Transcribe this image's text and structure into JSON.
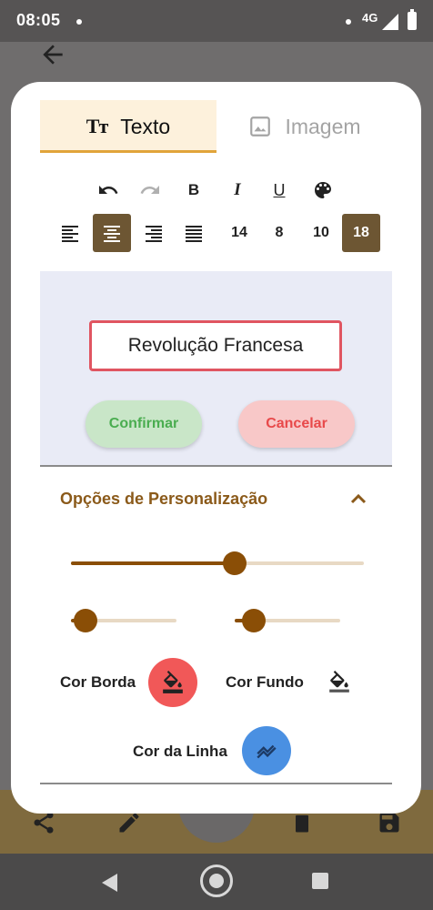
{
  "status_bar": {
    "time": "08:05",
    "network": "4G"
  },
  "tabs": [
    {
      "label": "Texto",
      "icon": "text-format-icon",
      "icon_glyph": "Tт",
      "selected": true
    },
    {
      "label": "Imagem",
      "icon": "image-icon",
      "selected": false
    }
  ],
  "format_row": [
    {
      "name": "undo-icon"
    },
    {
      "name": "redo-icon"
    },
    {
      "name": "bold",
      "glyph": "B"
    },
    {
      "name": "italic",
      "glyph": "I"
    },
    {
      "name": "underline",
      "glyph": "U"
    },
    {
      "name": "palette-icon"
    }
  ],
  "align_row": {
    "alignments": [
      "left",
      "center",
      "right",
      "justify"
    ],
    "selected_alignment": "center",
    "font_sizes": [
      "14",
      "8",
      "10",
      "18"
    ],
    "selected_font_size": "18"
  },
  "editor": {
    "input_value": "Revolução Francesa",
    "confirm_label": "Confirmar",
    "cancel_label": "Cancelar"
  },
  "customization": {
    "title": "Opções de Personalização",
    "expanded": true,
    "slider_main_fraction": 0.56,
    "slider_left_fraction": 0.14,
    "slider_right_fraction": 0.18,
    "border_color_label": "Cor Borda",
    "background_color_label": "Cor Fundo",
    "line_color_label": "Cor da Linha",
    "colors": {
      "border": "#f15858",
      "background": "#ffffff",
      "line": "#4a90e2",
      "accent": "#8a4e06"
    }
  }
}
